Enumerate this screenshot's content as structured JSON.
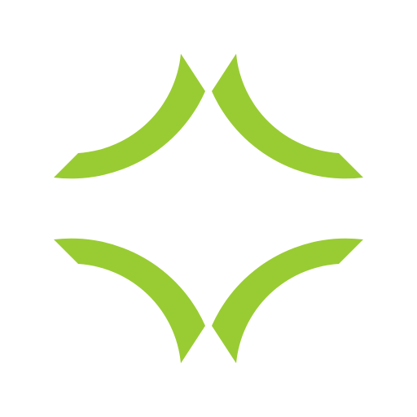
{
  "logo": {
    "icon": "four-arcs-logo-icon",
    "color": "#99CC33",
    "background": "#FFFFFF"
  }
}
